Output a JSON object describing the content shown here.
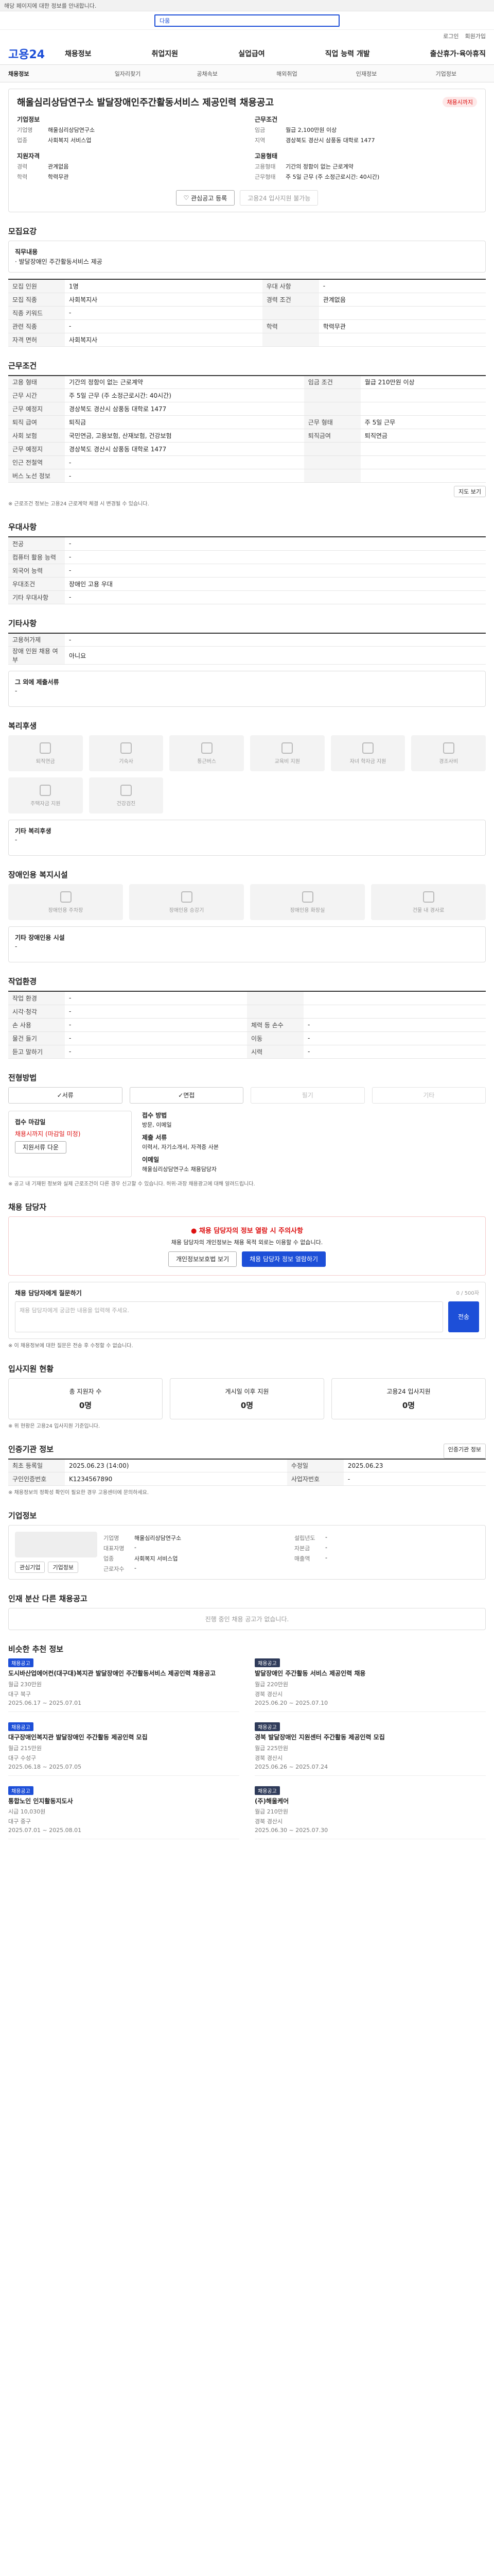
{
  "topbar": {
    "notice": "해당 페이지에 대한 정보를 안내합니다."
  },
  "search": {
    "text": "다움"
  },
  "util": {
    "login": "로그인",
    "join": "회원가입"
  },
  "logo": "고용24",
  "gnb": [
    "채용정보",
    "취업지원",
    "실업급여",
    "직업 능력 개발",
    "출산휴가·육아휴직"
  ],
  "subnav": [
    "채용정보",
    "일자리찾기",
    "공채속보",
    "해외취업",
    "인재정보",
    "기업정보"
  ],
  "job": {
    "title": "해울심리상담연구소 발달장애인주간활동서비스 제공인력 채용공고",
    "badge": "채용시까지",
    "company_label": "기업정보",
    "company": [
      {
        "k": "기업명",
        "v": "해울심리상담연구소"
      },
      {
        "k": "업종",
        "v": "사회복지 서비스업"
      }
    ],
    "work_label": "근무조건",
    "work": [
      {
        "k": "임금",
        "v": "월급 2,100만원 이상"
      },
      {
        "k": "지역",
        "v": "경상북도 경산시 삼풍동 대학로 1477"
      }
    ],
    "req_label": "지원자격",
    "req": [
      {
        "k": "경력",
        "v": "관계없음"
      },
      {
        "k": "학력",
        "v": "학력무관"
      }
    ],
    "emp_label": "고용형태",
    "emp": [
      {
        "k": "고용형태",
        "v": "기간의 정함이 없는 근로계약"
      },
      {
        "k": "근무형태",
        "v": "주 5일 근무 (주 소정근로시간: 40시간)"
      }
    ],
    "btn_save": "관심공고 등록",
    "btn_apply": "고용24 입사지원 불가능"
  },
  "sections": {
    "recruit": "모집요강",
    "work": "근무조건",
    "pref": "우대사항",
    "etc": "기타사항",
    "welfare": "복리후생",
    "disabled": "장애인용 복지시설",
    "env": "작업환경",
    "method": "전형방법",
    "apply": "채용 담당자",
    "stat": "입사지원 현황",
    "inst": "인증기관 정보",
    "comp": "기업정보",
    "same": "인재 분산 다른 채용공고",
    "rec": "비슷한 추천 정보"
  },
  "recruit": {
    "duty_label": "직무내용",
    "duty": "· 발달장애인 주간활동서비스 제공",
    "rows": [
      {
        "k": "모집 인원",
        "v": "1명",
        "k2": "우대 사항",
        "v2": "-"
      },
      {
        "k": "모집 직종",
        "v": "사회복지사",
        "k2": "경력 조건",
        "v2": "관계없음"
      },
      {
        "k": "직종 키워드",
        "v": "-",
        "k2": "",
        "v2": ""
      },
      {
        "k": "관련 직종",
        "v": "-",
        "k2": "학력",
        "v2": "학력무관"
      },
      {
        "k": "자격 면허",
        "v": "사회복지사",
        "k2": "",
        "v2": ""
      }
    ]
  },
  "work": {
    "rows": [
      {
        "k": "고용 형태",
        "v": "기간의 정함이 없는 근로계약",
        "k2": "임금 조건",
        "v2": "월급 210만원 이상"
      },
      {
        "k": "근무 시간",
        "v": "주 5일 근무 (주 소정근로시간: 40시간)",
        "k2": "",
        "v2": ""
      },
      {
        "k": "근무 예정지",
        "v": "경상북도 경산시 삼풍동 대학로 1477",
        "k2": "",
        "v2": ""
      },
      {
        "k": "퇴직 급여",
        "v": "퇴직금",
        "k2": "근무 형태",
        "v2": "주 5일 근무"
      },
      {
        "k": "사회 보험",
        "v": "국민연금, 고용보험, 산재보험, 건강보험",
        "k2": "퇴직금여",
        "v2": "퇴직연금"
      },
      {
        "k": "근무 예정지",
        "v": "경상북도 경산시 삼풍동 대학로 1477",
        "k2": "",
        "v2": ""
      },
      {
        "k": "인근 전철역",
        "v": "-",
        "k2": "",
        "v2": ""
      },
      {
        "k": "버스 노선 정보",
        "v": "-",
        "k2": "",
        "v2": ""
      }
    ],
    "map_btn": "지도 보기",
    "note": "※ 근로조건 정보는 고용24 근로계약 체결 시 변경될 수 있습니다."
  },
  "pref": {
    "rows": [
      {
        "k": "전공",
        "v": "-"
      },
      {
        "k": "컴퓨터 활용 능력",
        "v": "-"
      },
      {
        "k": "외국어 능력",
        "v": "-"
      },
      {
        "k": "우대조건",
        "v": "장애인 고용 우대"
      },
      {
        "k": "기타 우대사항",
        "v": "-"
      }
    ]
  },
  "etc": {
    "rows": [
      {
        "k": "고용허가제",
        "v": "-"
      },
      {
        "k": "장애 인원 채용 여부",
        "v": "아니요"
      }
    ],
    "box_title": "그 외에 제출서류",
    "box_text": "-"
  },
  "welfare": {
    "items": [
      "퇴직연금",
      "기숙사",
      "통근버스",
      "교육비 지원",
      "자녀 학자금 지원",
      "경조사비",
      "주택자금 지원",
      "건강검진"
    ],
    "box_title": "기타 복리후생",
    "box_text": "-"
  },
  "disabled": {
    "items": [
      "장애인용 주차장",
      "장애인용 승강기",
      "장애인용 화장실",
      "건물 내 경사로"
    ],
    "box_title": "기타 장애인용 시설",
    "box_text": "-"
  },
  "env": {
    "rows": [
      {
        "k": "작업 환경",
        "v": "-",
        "k2": "",
        "v2": ""
      },
      {
        "k": "시각·청각",
        "v": "-",
        "k2": "",
        "v2": ""
      },
      {
        "k": "손 사용",
        "v": "-",
        "k2": "체력 등 손수",
        "v2": "-"
      },
      {
        "k": "물건 들기",
        "v": "-",
        "k2": "이동",
        "v2": "-"
      },
      {
        "k": "듣고 말하기",
        "v": "-",
        "k2": "시력",
        "v2": "-"
      }
    ]
  },
  "method": {
    "items": [
      "서류",
      "면접",
      "필기",
      "기타"
    ],
    "active": [
      true,
      true,
      false,
      false
    ],
    "apply_label": "접수 마감일",
    "apply_value": "채용시까지 (마감일 미정)",
    "apply_btn": "지원서류 다운",
    "right": [
      {
        "k": "접수 방법",
        "v": "방문, 이메일"
      },
      {
        "k": "제출 서류",
        "v": "이력서, 자기소개서, 자격증 사본"
      },
      {
        "k": "이메일",
        "v": "해울심리상담연구소 채용담당자"
      }
    ],
    "notes": "※ 공고 내 기재된 정보와 실제 근로조건이 다른 경우 신고할 수 있습니다. 허위·과장 채용광고에 대해 알려드립니다."
  },
  "apply": {
    "warn_title": "채용 담당자의 정보 열람 시 주의사항",
    "warn_text": "채용 담당자의 개인정보는 채용 목적 외로는 이용할 수 없습니다.",
    "btn1": "개인정보보호법 보기",
    "btn2": "채용 담당자 정보 열람하기",
    "msg_label": "채용 담당자에게 질문하기",
    "msg_count": "0 / 500자",
    "placeholder": "채용 담당자에게 궁금한 내용을 입력해 주세요.",
    "send": "전송",
    "notes": "※ 이 채용정보에 대한 질문은 전송 후 수정할 수 없습니다."
  },
  "stat": {
    "items": [
      {
        "label": "총 지원자 수",
        "value": "0명"
      },
      {
        "label": "게시일 이후 지원",
        "value": "0명"
      },
      {
        "label": "고용24 입사지원",
        "value": "0명"
      }
    ],
    "note": "※ 위 현황은 고용24 입사지원 기준입니다."
  },
  "inst": {
    "badge": "인증기관 정보",
    "rows": [
      {
        "k": "최초 등록일",
        "v": "2025.06.23 (14:00)",
        "k2": "수정일",
        "v2": "2025.06.23"
      },
      {
        "k": "구인인증번호",
        "v": "K1234567890",
        "k2": "사업자번호",
        "v2": "-"
      }
    ],
    "notes": "※ 채용정보의 정확성 확인이 필요한 경우 고용센터에 문의하세요."
  },
  "comp": {
    "rows": [
      {
        "k": "기업명",
        "v": "해울심리상담연구소"
      },
      {
        "k": "대표자명",
        "v": "-"
      },
      {
        "k": "업종",
        "v": "사회복지 서비스업"
      },
      {
        "k": "근로자수",
        "v": "-"
      }
    ],
    "right": [
      {
        "k": "설립년도",
        "v": "-"
      },
      {
        "k": "자본금",
        "v": "-"
      },
      {
        "k": "매출액",
        "v": "-"
      }
    ],
    "btn1": "관심기업",
    "btn2": "기업정보"
  },
  "same": {
    "text": "진행 중인 채용 공고가 없습니다."
  },
  "rec": {
    "items": [
      {
        "tag": "채용공고",
        "dark": false,
        "name": "도시바산업에어컨(대구대)복지관 발달장애인 주간활동서비스 제공인력 채용공고",
        "pay": "월급 230만원",
        "loc": "대구 북구",
        "date": "2025.06.17 ~ 2025.07.01"
      },
      {
        "tag": "채용공고",
        "dark": true,
        "name": "발달장애인 주간활동 서비스 제공인력 채용",
        "pay": "월급 220만원",
        "loc": "경북 경산시",
        "date": "2025.06.20 ~ 2025.07.10"
      },
      {
        "tag": "채용공고",
        "dark": false,
        "name": "대구장애인복지관 발달장애인 주간활동 제공인력 모집",
        "pay": "월급 215만원",
        "loc": "대구 수성구",
        "date": "2025.06.18 ~ 2025.07.05"
      },
      {
        "tag": "채용공고",
        "dark": true,
        "name": "경북 발달장애인 지원센터 주간활동 제공인력 모집",
        "pay": "월급 225만원",
        "loc": "경북 경산시",
        "date": "2025.06.26 ~ 2025.07.24"
      },
      {
        "tag": "채용공고",
        "dark": false,
        "name": "통합노인 인지활동지도사",
        "pay": "시급 10,030원",
        "loc": "대구 중구",
        "date": "2025.07.01 ~ 2025.08.01"
      },
      {
        "tag": "채용공고",
        "dark": true,
        "name": "(주)해울케어",
        "pay": "월급 210만원",
        "loc": "경북 경산시",
        "date": "2025.06.30 ~ 2025.07.30"
      }
    ]
  }
}
